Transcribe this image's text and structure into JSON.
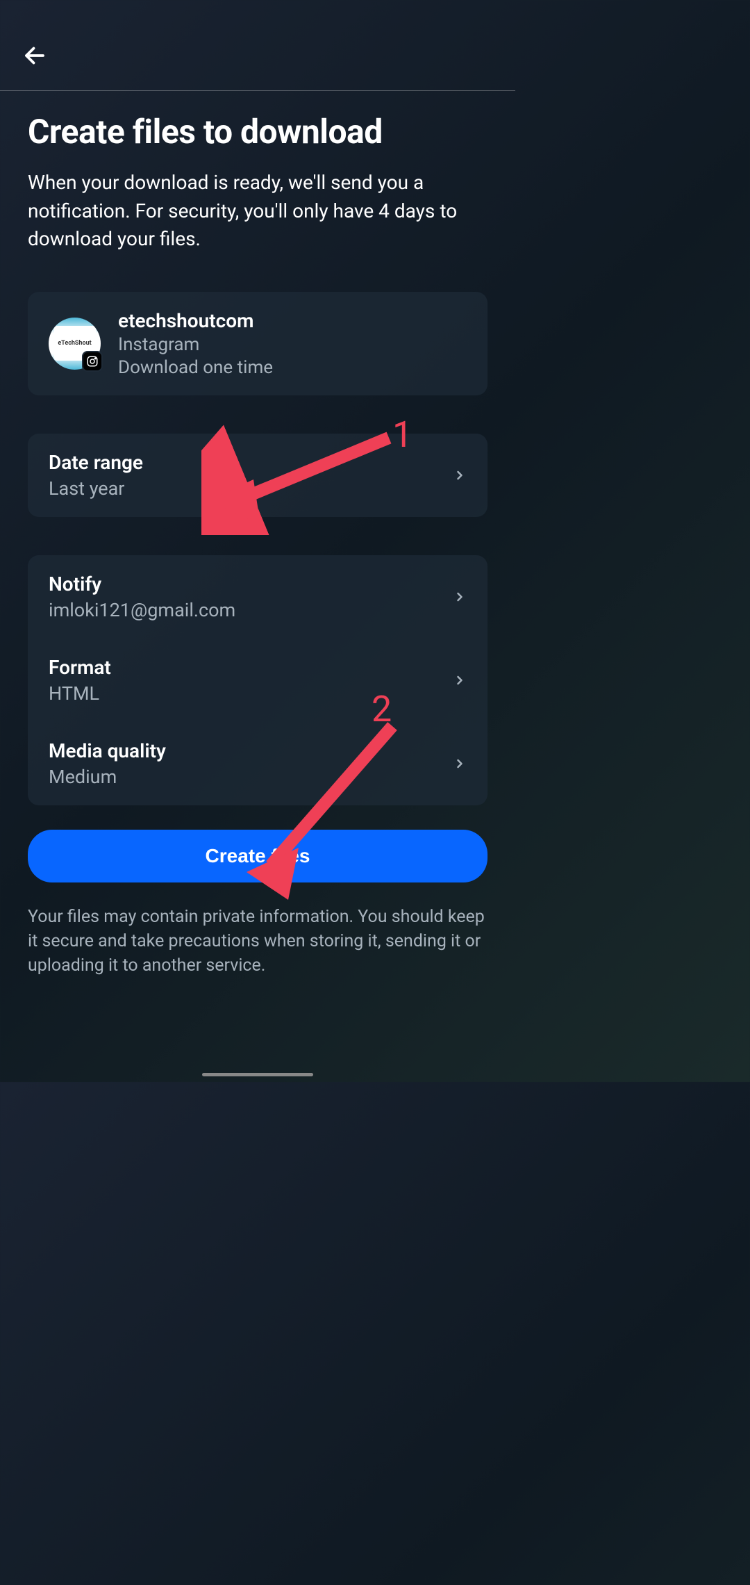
{
  "header": {
    "back_label": "Back"
  },
  "page": {
    "title": "Create files to download",
    "description": "When your download is ready, we'll send you a notification. For security, you'll only have 4 days to download your files."
  },
  "account": {
    "name": "etechshoutcom",
    "platform": "Instagram",
    "detail": "Download one time",
    "avatar_text": "eTechShout"
  },
  "date_range": {
    "label": "Date range",
    "value": "Last year"
  },
  "notify": {
    "label": "Notify",
    "value": "imloki121@gmail.com"
  },
  "format": {
    "label": "Format",
    "value": "HTML"
  },
  "media_quality": {
    "label": "Media quality",
    "value": "Medium"
  },
  "create_button": {
    "label": "Create files"
  },
  "disclaimer": "Your files may contain private information. You should keep it secure and take precautions when storing it, sending it or uploading it to another service.",
  "annotations": {
    "one": "1",
    "two": "2"
  }
}
